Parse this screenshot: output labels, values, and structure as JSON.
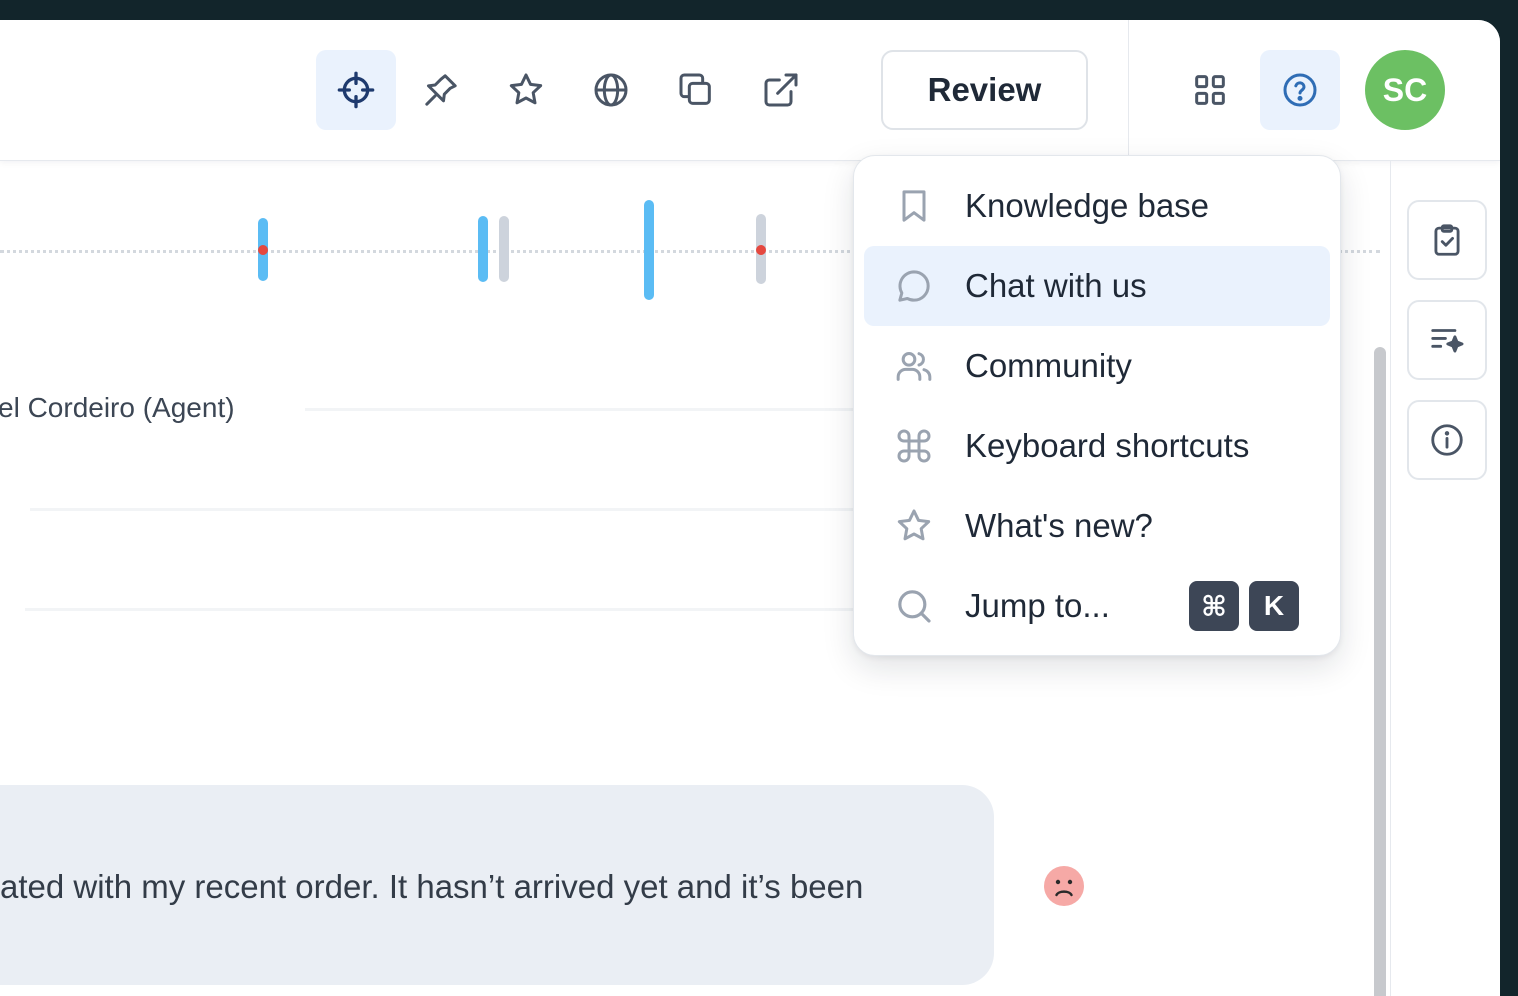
{
  "toolbar": {
    "review_label": "Review",
    "avatar_initials": "SC",
    "avatar_color": "#6cc063",
    "tools": [
      {
        "icon": "crosshair-icon",
        "active": true
      },
      {
        "icon": "pin-icon",
        "active": false
      },
      {
        "icon": "star-icon",
        "active": false
      },
      {
        "icon": "globe-icon",
        "active": false
      },
      {
        "icon": "copy-icon",
        "active": false
      },
      {
        "icon": "external-link-icon",
        "active": false
      }
    ]
  },
  "conversation": {
    "participant_label": "el Cordeiro (Agent)",
    "message_text": "ated with my recent order. It hasn’t arrived yet and it’s been",
    "sentiment_icon": "sad-face-icon"
  },
  "help_menu": {
    "items": [
      {
        "label": "Knowledge base",
        "icon": "bookmark-icon"
      },
      {
        "label": "Chat with us",
        "icon": "chat-bubble-icon"
      },
      {
        "label": "Community",
        "icon": "users-icon"
      },
      {
        "label": "Keyboard shortcuts",
        "icon": "command-icon"
      },
      {
        "label": "What's new?",
        "icon": "star-icon"
      },
      {
        "label": "Jump to...",
        "icon": "search-icon"
      }
    ],
    "jump_shortcut": [
      "⌘",
      "K"
    ]
  },
  "right_rail": {
    "buttons": [
      "clipboard-check-icon",
      "sparkle-list-icon",
      "info-icon"
    ]
  },
  "colors": {
    "accent": "#2f6db5",
    "timeline_blue": "#5bbcf4",
    "alert_red": "#e5483f",
    "menu_hover": "#eaf2fd"
  }
}
